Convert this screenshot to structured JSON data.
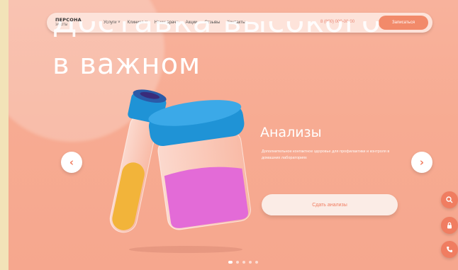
{
  "brand": {
    "logo_line1": "ПЕРСОНА",
    "logo_line2": "ЗАБОТЫ"
  },
  "nav": {
    "items": [
      "Услуги ˅",
      "Клиника ˅",
      "Наши врачи",
      "Акции",
      "Отзывы",
      "Контакты"
    ],
    "phone": "8 (800) 000-00-00",
    "record_label": "Записаться"
  },
  "hero": {
    "heading_line1": "Доставка высокого",
    "heading_line2": "в важном"
  },
  "slide": {
    "title": "Анализы",
    "description": "Дополнительное контактное здоровье для профилактики и контроля в домашних лабораториях",
    "cta_label": "Сдать анализы"
  },
  "controls": {
    "prev_arrow": "‹",
    "next_arrow": "›",
    "slide_count": 5,
    "active_slide": 1
  },
  "colors": {
    "background": "#f6a78e",
    "accent": "#f07d61",
    "nav_bg": "#fde3da"
  },
  "icons": [
    "search-icon",
    "lock-icon",
    "phone-icon"
  ]
}
